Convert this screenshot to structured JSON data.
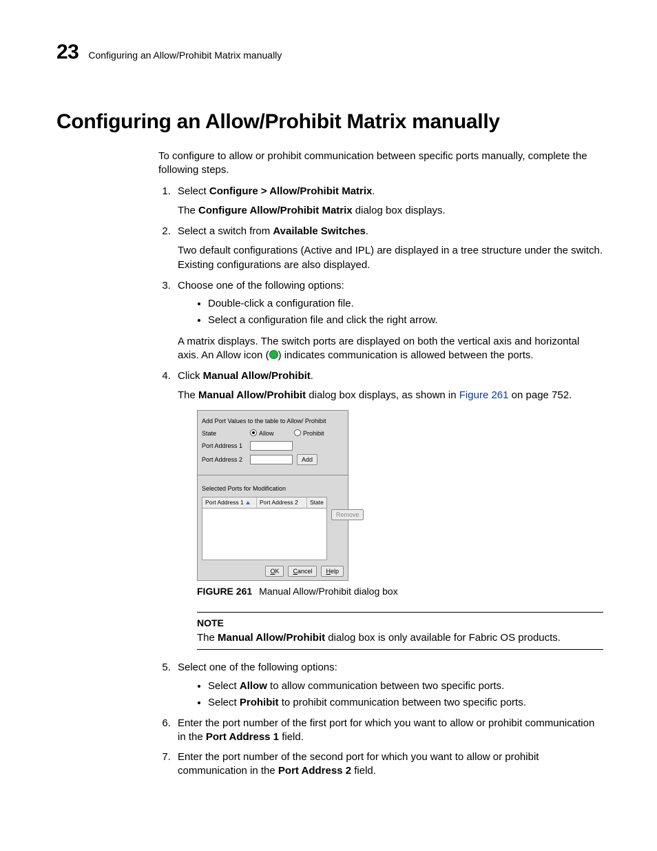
{
  "header": {
    "chapter_number": "23",
    "running_title": "Configuring an Allow/Prohibit Matrix manually"
  },
  "title": "Configuring an Allow/Prohibit Matrix manually",
  "intro": "To configure to allow or prohibit communication between specific ports manually, complete the following steps.",
  "steps": {
    "s1": {
      "lead": "Select ",
      "bold": "Configure > Allow/Prohibit Matrix",
      "tail": ".",
      "sub_a": "The ",
      "sub_b": "Configure Allow/Prohibit Matrix",
      "sub_c": " dialog box displays."
    },
    "s2": {
      "lead": "Select a switch from ",
      "bold": "Available Switches",
      "tail": ".",
      "sub": "Two default configurations (Active and IPL) are displayed in a tree structure under the switch. Existing configurations are also displayed."
    },
    "s3": {
      "text": "Choose one of the following options:",
      "bul1": "Double-click a configuration file.",
      "bul2": "Select a configuration file and click the right arrow.",
      "sub_a": "A matrix displays. The switch ports are displayed on both the vertical axis and horizontal axis. An Allow icon (",
      "sub_b": ") indicates communication is allowed between the ports."
    },
    "s4": {
      "lead": "Click ",
      "bold": "Manual Allow/Prohibit",
      "tail": ".",
      "sub_a": "The ",
      "sub_b": "Manual Allow/Prohibit",
      "sub_c": " dialog box displays, as shown in ",
      "link": "Figure 261",
      "sub_d": " on page 752."
    },
    "s5": {
      "text": "Select one of the following options:",
      "b1a": "Select ",
      "b1b": "Allow",
      "b1c": " to allow communication between two specific ports.",
      "b2a": "Select ",
      "b2b": "Prohibit",
      "b2c": " to prohibit communication between two specific ports."
    },
    "s6": {
      "a": "Enter the port number of the first port for which you want to allow or prohibit communication in the ",
      "b": "Port Address 1",
      "c": " field."
    },
    "s7": {
      "a": "Enter the port number of the second port for which you want to allow or prohibit communication in the ",
      "b": "Port Address 2",
      "c": " field."
    }
  },
  "dialog": {
    "title": "Add Port Values to the table to Allow/ Prohibit",
    "state_label": "State",
    "allow": "Allow",
    "prohibit": "Prohibit",
    "port1": "Port Address 1",
    "port2": "Port Address 2",
    "add": "Add",
    "section2": "Selected Ports for Modification",
    "col1": "Port Address 1",
    "col2": "Port Address 2",
    "col3": "State",
    "remove": "Remove",
    "ok_u": "O",
    "ok_r": "K",
    "cancel_u": "C",
    "cancel_r": "ancel",
    "help_u": "H",
    "help_r": "elp"
  },
  "figure": {
    "label": "FIGURE 261",
    "caption": "Manual Allow/Prohibit dialog box"
  },
  "note": {
    "head": "NOTE",
    "a": "The ",
    "b": "Manual Allow/Prohibit",
    "c": " dialog box is only available for Fabric OS products."
  }
}
